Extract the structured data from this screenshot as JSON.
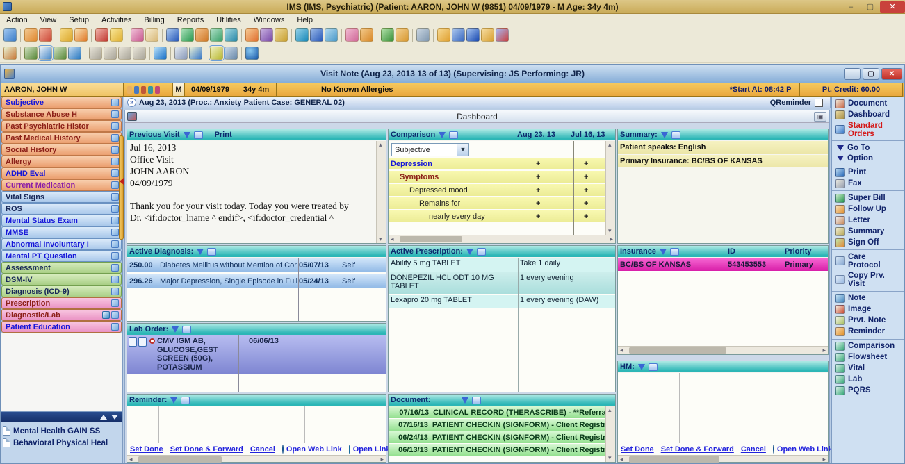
{
  "titlebar": {
    "title": "IMS (IMS, Psychiatric)    (Patient: AARON, JOHN W (9851) 04/09/1979 - M Age: 34y 4m)",
    "minimize": "–",
    "maximize": "▢",
    "close": "✕"
  },
  "menubar": {
    "items": [
      "Action",
      "View",
      "Setup",
      "Activities",
      "Billing",
      "Reports",
      "Utilities",
      "Windows",
      "Help"
    ]
  },
  "visit_note": {
    "title": "Visit Note (Aug 23, 2013   13 of 13) (Supervising: JS Performing: JR)",
    "minimize": "–",
    "maximize": "▢",
    "close": "✕"
  },
  "patient_bar": {
    "name": "AARON, JOHN W",
    "sex": "M",
    "dob": "04/09/1979",
    "age": "34y 4m",
    "allergies": "No Known Allergies",
    "start_at": "*Start At: 08:42 P",
    "credit": "Pt. Credit: 60.00"
  },
  "visit_header": {
    "label": "Aug 23, 2013  (Proc.: Anxiety Patient  Case: GENERAL 02)",
    "qreminder_label": "QReminder"
  },
  "left_sidebar": {
    "items": [
      {
        "label": "Subjective"
      },
      {
        "label": "Substance Abuse H"
      },
      {
        "label": "Past Psychiatric Histor"
      },
      {
        "label": "Past Medical History"
      },
      {
        "label": "Social History"
      },
      {
        "label": "Allergy"
      },
      {
        "label": "ADHD Eval"
      },
      {
        "label": "Current Medication"
      },
      {
        "label": "Vital Signs"
      },
      {
        "label": "ROS"
      },
      {
        "label": "Mental Status Exam"
      },
      {
        "label": "MMSE"
      },
      {
        "label": "Abnormal Involuntary I"
      },
      {
        "label": "Mental PT Question"
      },
      {
        "label": "Assessment"
      },
      {
        "label": "DSM-IV"
      },
      {
        "label": "Diagnosis (ICD-9)"
      },
      {
        "label": "Prescription"
      },
      {
        "label": "Diagnostic/Lab"
      },
      {
        "label": "Patient Education"
      }
    ],
    "bottom_items": [
      {
        "label": "Mental Health GAIN SS"
      },
      {
        "label": "Behavioral Physical Heal"
      }
    ]
  },
  "dashboard": {
    "title": "Dashboard",
    "previous_visit": {
      "title": "Previous Visit",
      "print_label": "Print",
      "text": "Jul 16, 2013\nOffice Visit\nJOHN AARON\n04/09/1979\n\nThank you for your visit today. Today you were treated by\nDr. <if:doctor_lname ^ endif>, <if:doctor_credential ^"
    },
    "comparison": {
      "title": "Comparison",
      "col1": "Aug 23, 13",
      "col2": "Jul 16, 13",
      "dropdown_value": "Subjective",
      "rows": [
        {
          "label": "Depression",
          "v1": "+",
          "v2": "+"
        },
        {
          "label": "Symptoms",
          "v1": "+",
          "v2": "+"
        },
        {
          "label": "Depressed mood",
          "v1": "+",
          "v2": "+"
        },
        {
          "label": "Remains for",
          "v1": "+",
          "v2": "+"
        },
        {
          "label": "nearly every day",
          "v1": "+",
          "v2": "+"
        }
      ]
    },
    "summary": {
      "title": "Summary:",
      "rows": [
        {
          "text": "Patient speaks: English"
        },
        {
          "text": "Primary Insurance: BC/BS OF KANSAS"
        }
      ]
    },
    "active_diagnosis": {
      "title": "Active Diagnosis:",
      "rows": [
        {
          "code": "250.00",
          "desc": "Diabetes Mellitus without Mention of Con",
          "date": "05/07/13",
          "src": "Self"
        },
        {
          "code": "296.26",
          "desc": "Major Depression, Single Episode in Full",
          "date": "05/24/13",
          "src": "Self"
        }
      ]
    },
    "active_prescription": {
      "title": "Active Prescription:",
      "rows": [
        {
          "drug": "Abilify 5 mg TABLET",
          "sig": "Take 1 daily"
        },
        {
          "drug": "DONEPEZIL HCL ODT 10 MG TABLET",
          "sig": "1 every evening"
        },
        {
          "drug": "Lexapro 20 mg TABLET",
          "sig": "1 every evening (DAW)"
        }
      ]
    },
    "insurance": {
      "title": "Insurance",
      "col_id": "ID",
      "col_priority": "Priority",
      "rows": [
        {
          "name": "BC/BS OF KANSAS",
          "id": "543453553",
          "priority": "Primary"
        }
      ]
    },
    "lab_order": {
      "title": "Lab Order:",
      "rows": [
        {
          "tests": "CMV IGM AB, GLUCOSE,GEST SCREEN (50G), POTASSIUM",
          "date": "06/06/13"
        }
      ]
    },
    "reminder": {
      "title": "Reminder:"
    },
    "hm": {
      "title": "HM:"
    },
    "document": {
      "title": "Document:",
      "rows": [
        {
          "date": "07/16/13",
          "text": "CLINICAL RECORD (THERASCRIBE)  - **Referra"
        },
        {
          "date": "07/16/13",
          "text": "PATIENT CHECKIN (SIGNFORM)  - Client Registra"
        },
        {
          "date": "06/24/13",
          "text": "PATIENT CHECKIN (SIGNFORM)  - Client Registra"
        },
        {
          "date": "06/13/13",
          "text": "PATIENT CHECKIN (SIGNFORM)  - Client Registra"
        }
      ]
    },
    "links": {
      "set_done": "Set Done",
      "set_done_forward": "Set Done & Forward",
      "cancel": "Cancel",
      "open_web_link": "Open Web Link",
      "open_link": "Open Link"
    }
  },
  "right_sidebar": {
    "items": [
      {
        "label": "Document"
      },
      {
        "label": "Dashboard"
      },
      {
        "label": "Standard Orders"
      },
      {
        "label": "Go To"
      },
      {
        "label": "Option"
      },
      {
        "label": "Print"
      },
      {
        "label": "Fax"
      },
      {
        "label": "Super Bill"
      },
      {
        "label": "Follow Up"
      },
      {
        "label": "Letter"
      },
      {
        "label": "Summary"
      },
      {
        "label": "Sign Off"
      },
      {
        "label": "Care Protocol"
      },
      {
        "label": "Copy Prv. Visit"
      },
      {
        "label": "Note"
      },
      {
        "label": "Image"
      },
      {
        "label": "Prvt. Note"
      },
      {
        "label": "Reminder"
      },
      {
        "label": "Comparison"
      },
      {
        "label": "Flowsheet"
      },
      {
        "label": "Vital"
      },
      {
        "label": "Lab"
      },
      {
        "label": "PQRS"
      }
    ]
  }
}
